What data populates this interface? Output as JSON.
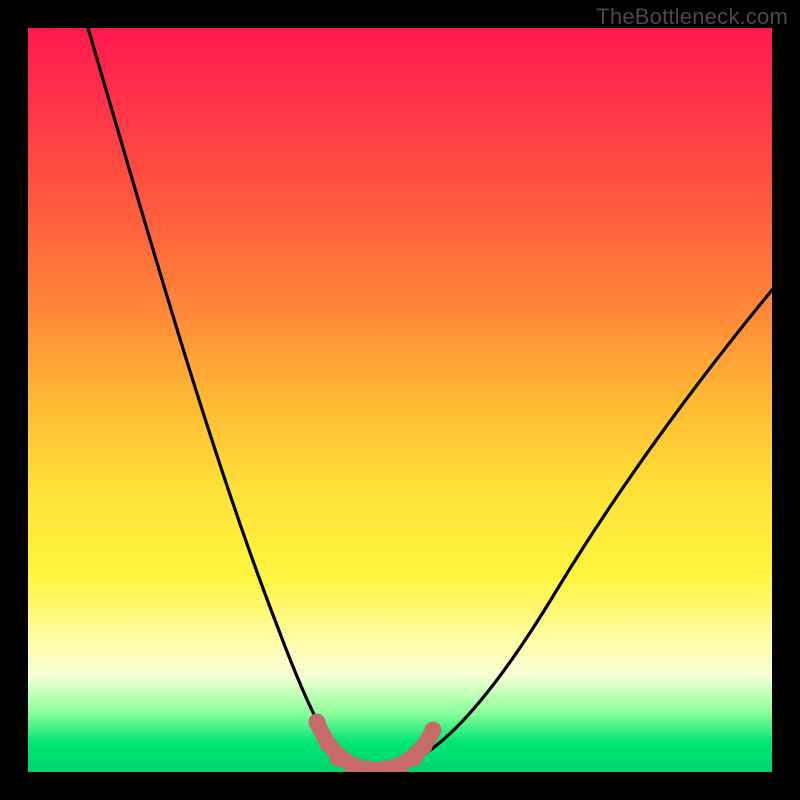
{
  "watermark": "TheBottleneck.com",
  "chart_data": {
    "type": "line",
    "title": "",
    "xlabel": "",
    "ylabel": "",
    "xlim": [
      0,
      100
    ],
    "ylim": [
      0,
      100
    ],
    "series": [
      {
        "name": "bottleneck-curve",
        "x": [
          8,
          12,
          16,
          20,
          24,
          28,
          32,
          36,
          38,
          40,
          42,
          44,
          46,
          48,
          50,
          55,
          60,
          65,
          70,
          75,
          80,
          85,
          90,
          95,
          100
        ],
        "y": [
          100,
          90,
          80,
          70,
          60,
          50,
          40,
          25,
          15,
          8,
          4,
          2,
          1,
          1,
          2,
          6,
          14,
          24,
          34,
          43,
          51,
          58,
          64,
          69,
          73
        ]
      },
      {
        "name": "bottom-markers",
        "x": [
          38,
          40,
          42,
          44,
          46,
          48,
          50,
          52
        ],
        "y": [
          6,
          3,
          1.5,
          1,
          1,
          1.5,
          3,
          6
        ]
      }
    ],
    "colors": {
      "curve": "#000000",
      "markers": "#c86a6a",
      "gradient_top": "#ff1a4d",
      "gradient_mid": "#ffe137",
      "gradient_bottom": "#00d56c"
    }
  }
}
